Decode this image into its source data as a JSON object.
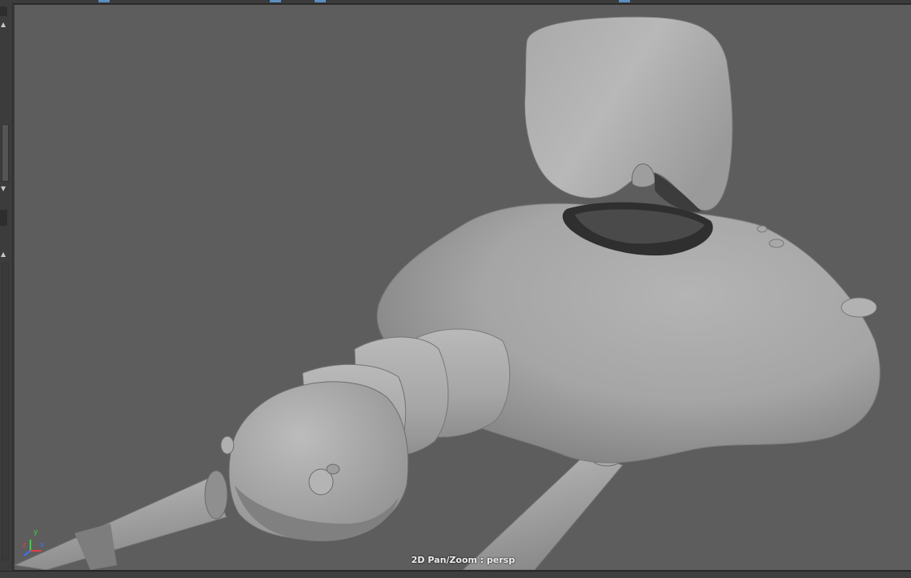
{
  "viewport": {
    "camera": "persp",
    "hud_text": "2D Pan/Zoom : persp",
    "background_color": "#5d5d5d"
  },
  "axis_gizmo": {
    "x_label": "x",
    "y_label": "y",
    "z_label": "z",
    "x_color": "#e04040",
    "y_color": "#40d040",
    "z_color": "#4070ff"
  },
  "left_panel": {
    "arrow_up": "▲",
    "arrow_down": "▼"
  }
}
